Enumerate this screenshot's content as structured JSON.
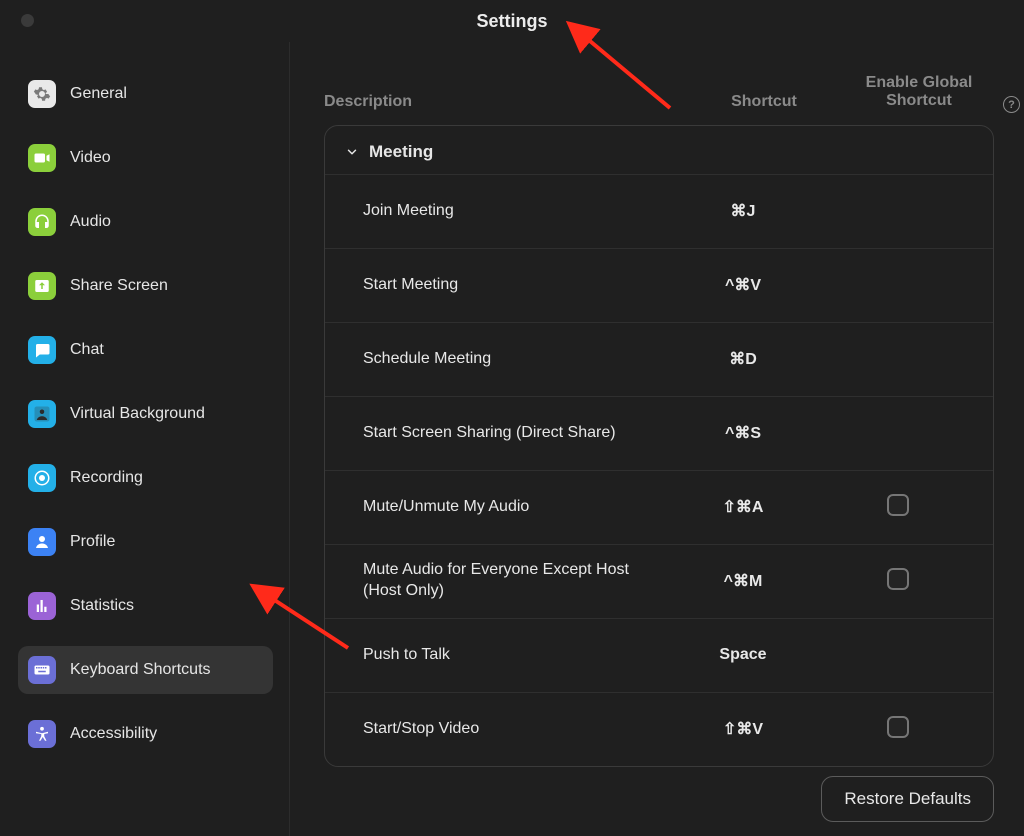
{
  "window": {
    "title": "Settings"
  },
  "sidebar": {
    "items": [
      {
        "id": "general",
        "label": "General",
        "icon": "gear-icon",
        "bg": "#e9e9e9",
        "fg": "#7a7a7a"
      },
      {
        "id": "video",
        "label": "Video",
        "icon": "video-icon",
        "bg": "#8bcf3b",
        "fg": "#ffffff"
      },
      {
        "id": "audio",
        "label": "Audio",
        "icon": "headphones-icon",
        "bg": "#8bcf3b",
        "fg": "#ffffff"
      },
      {
        "id": "share",
        "label": "Share Screen",
        "icon": "share-icon",
        "bg": "#8bcf3b",
        "fg": "#ffffff"
      },
      {
        "id": "chat",
        "label": "Chat",
        "icon": "chat-icon",
        "bg": "#23b0e8",
        "fg": "#ffffff"
      },
      {
        "id": "vbg",
        "label": "Virtual Background",
        "icon": "person-icon",
        "bg": "#23b0e8",
        "fg": "#2b2b2b"
      },
      {
        "id": "recording",
        "label": "Recording",
        "icon": "record-icon",
        "bg": "#23b0e8",
        "fg": "#ffffff"
      },
      {
        "id": "profile",
        "label": "Profile",
        "icon": "profile-icon",
        "bg": "#3c82f4",
        "fg": "#ffffff"
      },
      {
        "id": "stats",
        "label": "Statistics",
        "icon": "stats-icon",
        "bg": "#9b63d6",
        "fg": "#ffffff"
      },
      {
        "id": "shortcuts",
        "label": "Keyboard Shortcuts",
        "icon": "keyboard-icon",
        "bg": "#6b6fd6",
        "fg": "#ffffff",
        "active": true
      },
      {
        "id": "access",
        "label": "Accessibility",
        "icon": "accessibility-icon",
        "bg": "#6b6fd6",
        "fg": "#ffffff"
      }
    ]
  },
  "columns": {
    "description": "Description",
    "shortcut": "Shortcut",
    "global": "Enable Global Shortcut"
  },
  "section": {
    "title": "Meeting"
  },
  "rows": [
    {
      "desc": "Join Meeting",
      "shortcut": "⌘J",
      "global": null
    },
    {
      "desc": "Start Meeting",
      "shortcut": "^⌘V",
      "global": null
    },
    {
      "desc": "Schedule Meeting",
      "shortcut": "⌘D",
      "global": null
    },
    {
      "desc": "Start Screen Sharing (Direct Share)",
      "shortcut": "^⌘S",
      "global": null
    },
    {
      "desc": "Mute/Unmute My Audio",
      "shortcut": "⇧⌘A",
      "global": false
    },
    {
      "desc": "Mute Audio for Everyone Except Host (Host Only)",
      "shortcut": "^⌘M",
      "global": false
    },
    {
      "desc": "Push to Talk",
      "shortcut": "Space",
      "global": null
    },
    {
      "desc": "Start/Stop Video",
      "shortcut": "⇧⌘V",
      "global": false
    }
  ],
  "footer": {
    "restore": "Restore Defaults"
  },
  "annotations": {
    "arrows": [
      {
        "points_to": "window-title",
        "color": "#ff2a1a"
      },
      {
        "points_to": "sidebar-item-shortcuts",
        "color": "#ff2a1a"
      }
    ]
  }
}
